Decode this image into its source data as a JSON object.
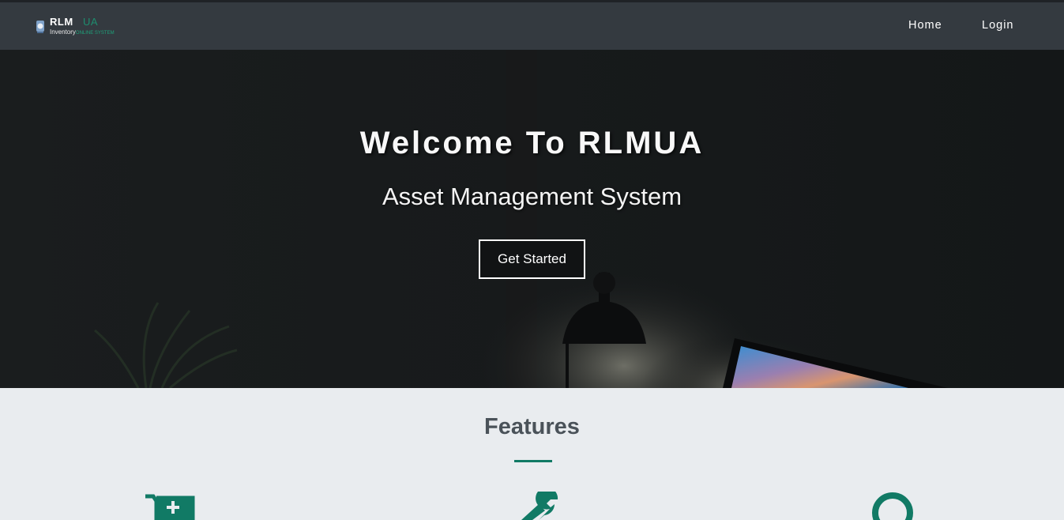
{
  "navbar": {
    "logo": {
      "brand_main": "RLM",
      "brand_accent": "UA",
      "subtitle": "Inventory",
      "subtitle_accent": "ONLINE SYSTEM"
    },
    "links": [
      {
        "label": "Home"
      },
      {
        "label": "Login"
      }
    ]
  },
  "hero": {
    "title": "Welcome To RLMUA",
    "subtitle": "Asset Management System",
    "cta_label": "Get Started"
  },
  "features": {
    "title": "Features",
    "icons": [
      "cart-plus-icon",
      "wrench-icon",
      "search-icon"
    ]
  },
  "colors": {
    "navbar": "#343a40",
    "accent": "#117a65",
    "features_bg": "#e9ecef",
    "hero_bg": "#141718"
  }
}
